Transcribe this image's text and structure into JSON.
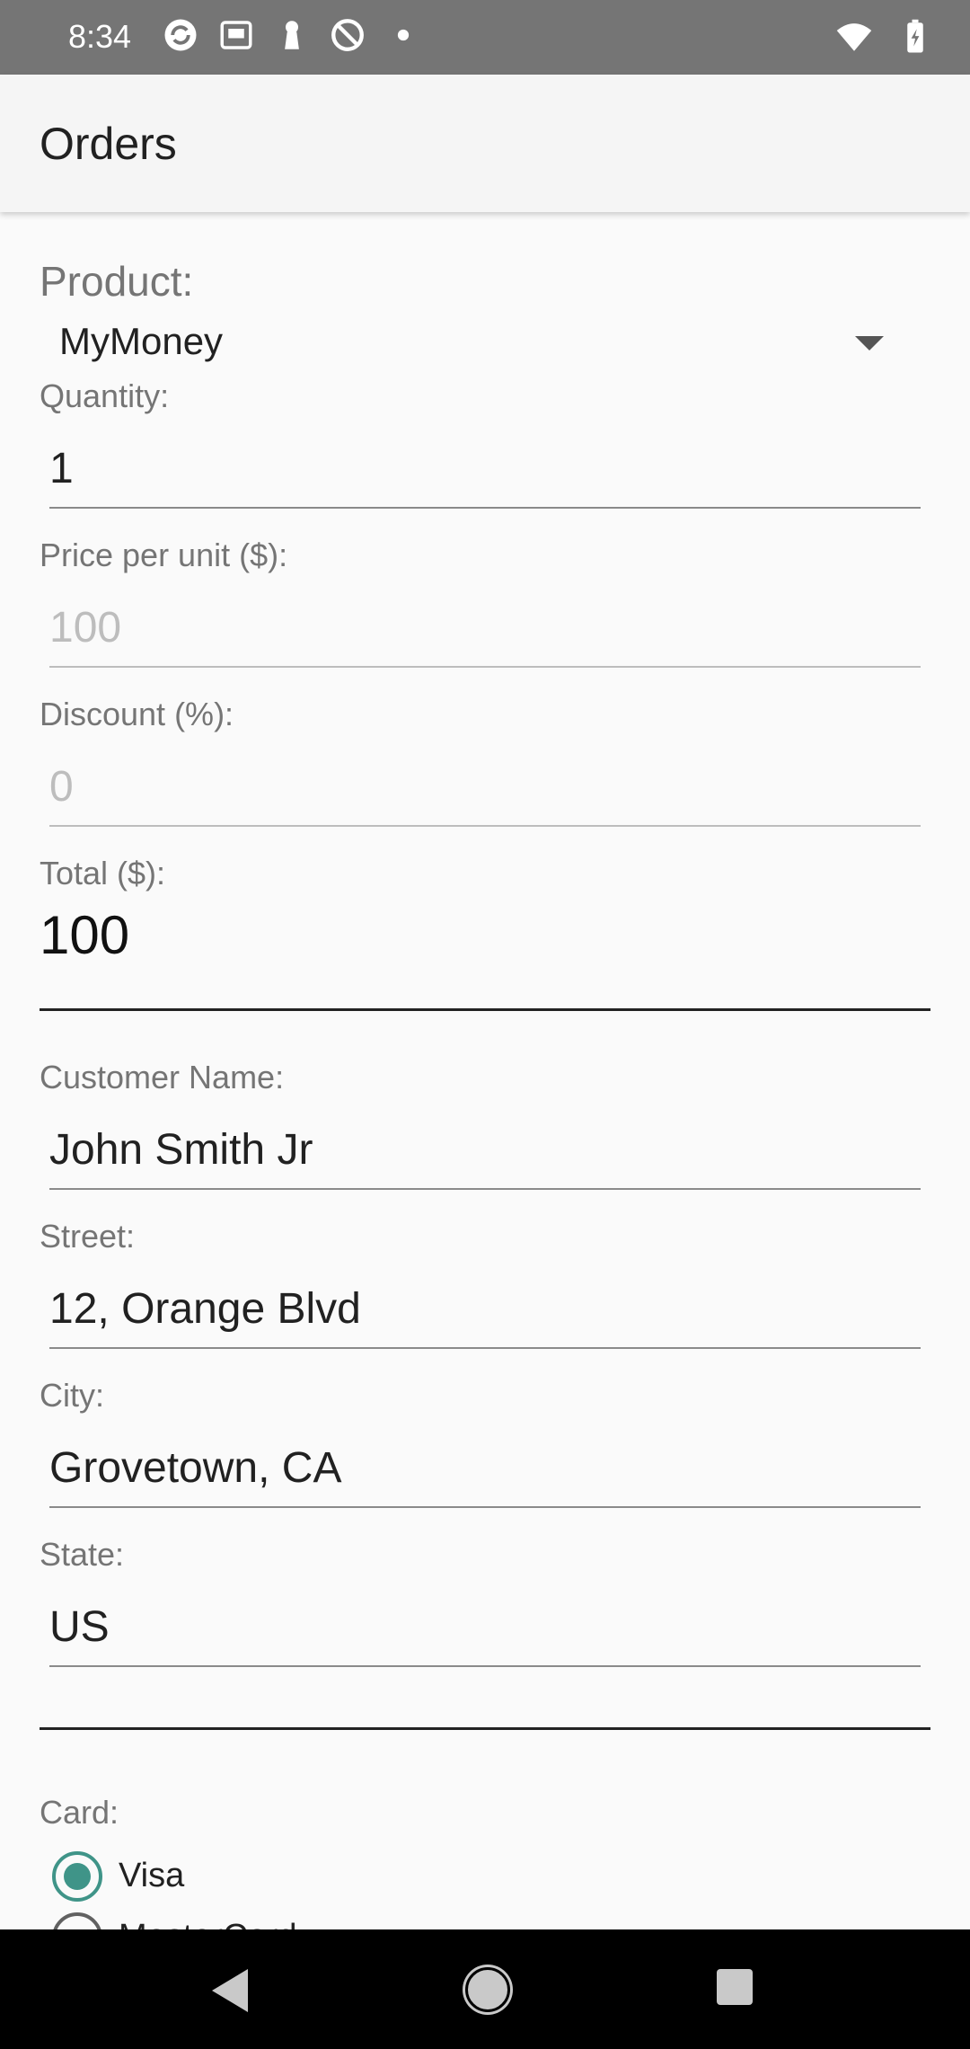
{
  "status_bar": {
    "time": "8:34",
    "left_icons": [
      "sync-icon",
      "photo-icon",
      "keyhole-icon",
      "blocked-icon",
      "dot-icon"
    ],
    "right_icons": [
      "wifi-icon",
      "battery-charging-icon"
    ]
  },
  "app_bar": {
    "title": "Orders"
  },
  "form": {
    "product": {
      "label": "Product:",
      "value": "MyMoney"
    },
    "quantity": {
      "label": "Quantity:",
      "value": "1"
    },
    "price": {
      "label": "Price per unit ($):",
      "value": "100"
    },
    "discount": {
      "label": "Discount (%):",
      "value": "0"
    },
    "total": {
      "label": "Total ($):",
      "value": "100"
    },
    "customer_name": {
      "label": "Customer Name:",
      "value": "John Smith Jr"
    },
    "street": {
      "label": "Street:",
      "value": "12, Orange Blvd"
    },
    "city": {
      "label": "City:",
      "value": "Grovetown, CA"
    },
    "state": {
      "label": "State:",
      "value": "US"
    },
    "card": {
      "label": "Card:",
      "options": [
        {
          "label": "Visa",
          "selected": true
        },
        {
          "label": "MasterCard",
          "selected": false
        }
      ]
    }
  },
  "theme": {
    "accent": "#3f9488",
    "status_bar": "#757575",
    "app_bar": "#f5f5f5",
    "background": "#fafafa"
  },
  "nav_bar": {
    "icons": [
      "back-icon",
      "home-icon",
      "recents-icon"
    ]
  }
}
